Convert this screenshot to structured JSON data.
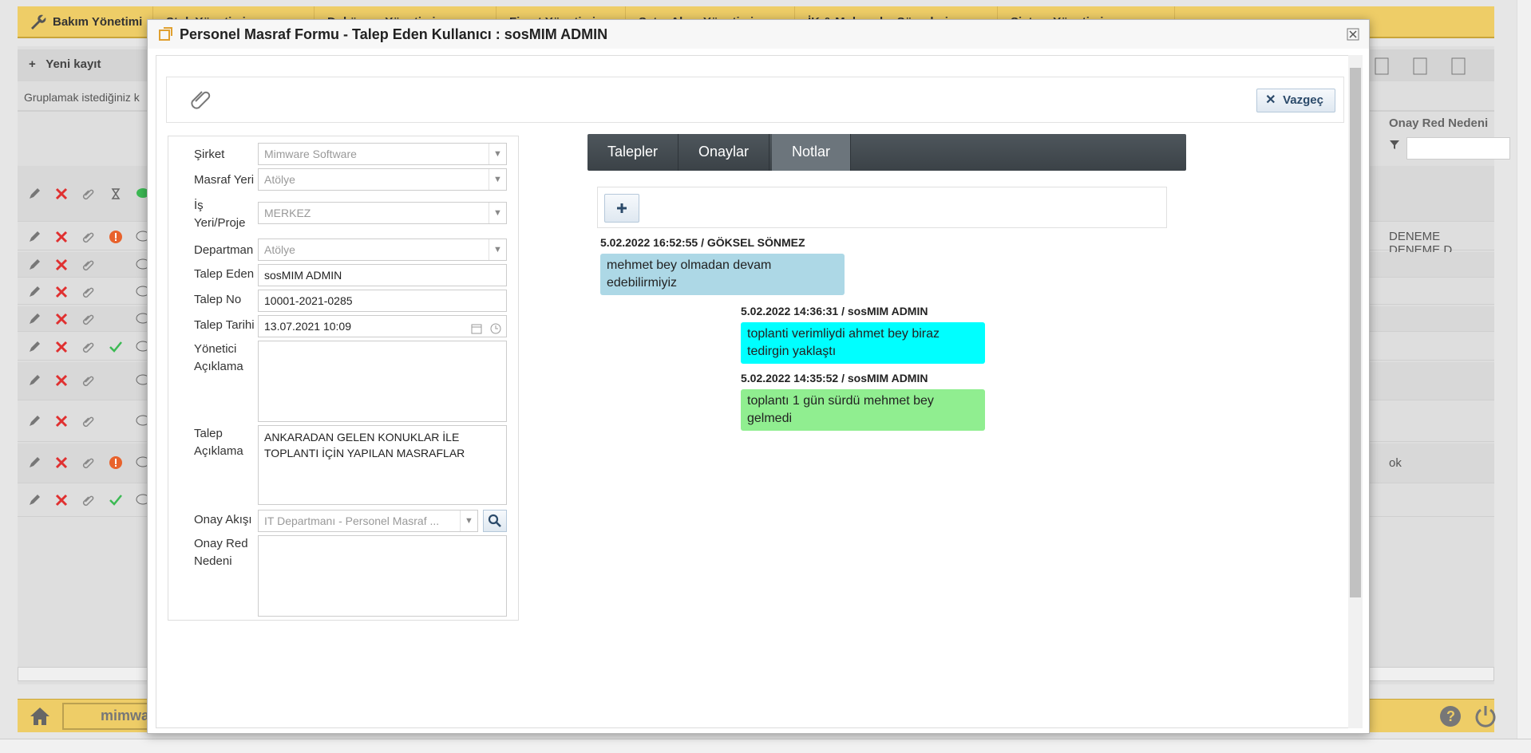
{
  "app": {
    "nav": [
      {
        "label": "Bakım Yönetimi"
      },
      {
        "label": "Stok Yönetimi"
      },
      {
        "label": "Doküman Yönetimi"
      },
      {
        "label": "Firsat Yönetimi"
      },
      {
        "label": "Satın Alma Yönetimi"
      },
      {
        "label": "İK & Muhasebe Süreçleri"
      },
      {
        "label": "Sistem Yönetimi"
      }
    ],
    "toolbar": {
      "new_record": "Yeni kayıt"
    },
    "group_hint": "Gruplamak istediğiniz k",
    "grid_header_right": "Onay Red Nedeni",
    "grid_rows_right": {
      "row2": "DENEME DENEME D",
      "row9": "ok"
    },
    "bottom_logo": "mimware"
  },
  "modal": {
    "title": "Personel Masraf Formu - Talep Eden Kullanıcı : sosMIM ADMIN",
    "cancel_label": "Vazgeç",
    "form": {
      "company_label": "Şirket",
      "company_value": "Mimware Software",
      "expense_place_label": "Masraf Yeri",
      "expense_place_value": "Atölye",
      "project_label": "İş Yeri/Proje",
      "project_value": "MERKEZ",
      "department_label": "Departman",
      "department_value": "Atölye",
      "requester_label": "Talep Eden",
      "requester_value": "sosMIM ADMIN",
      "request_no_label": "Talep No",
      "request_no_value": "10001-2021-0285",
      "request_date_label": "Talep Tarihi",
      "request_date_value": "13.07.2021 10:09",
      "manager_note_label": "Yönetici Açıklama",
      "manager_note_value": "",
      "request_note_label": "Talep Açıklama",
      "request_note_value": "ANKARADAN GELEN KONUKLAR İLE TOPLANTI İÇİN YAPILAN MASRAFLAR",
      "approval_flow_label": "Onay Akışı",
      "approval_flow_value": "IT Departmanı - Personel Masraf ...",
      "reject_reason_label": "Onay Red Nedeni",
      "reject_reason_value": ""
    },
    "tabs": [
      {
        "label": "Talepler",
        "active": false
      },
      {
        "label": "Onaylar",
        "active": false
      },
      {
        "label": "Notlar",
        "active": true
      }
    ],
    "notes": [
      {
        "meta": "5.02.2022 16:52:55 / GÖKSEL SÖNMEZ",
        "text": "mehmet bey olmadan devam edebilirmiyiz",
        "color": "#add8e6"
      },
      {
        "meta": "5.02.2022 14:36:31 / sosMIM ADMIN",
        "text": "toplanti verimliydi ahmet bey biraz tedirgin yaklaştı",
        "color": "#00ffff"
      },
      {
        "meta": "5.02.2022 14:35:52 / sosMIM ADMIN",
        "text": "toplantı 1 gün sürdü mehmet bey gelmedi",
        "color": "#90ee90"
      }
    ]
  }
}
